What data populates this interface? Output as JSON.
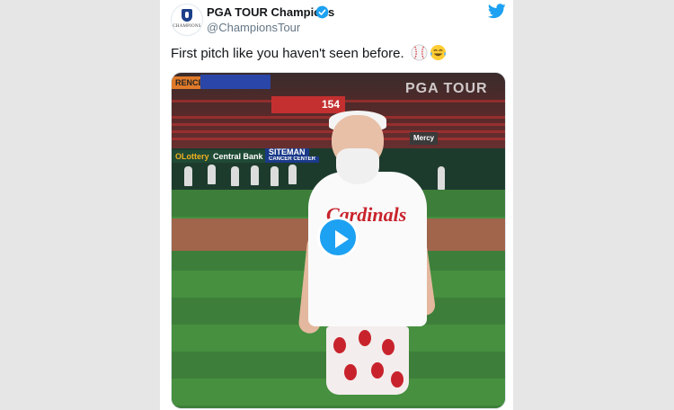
{
  "tweet": {
    "author_name": "PGA TOUR Champions",
    "author_handle": "@ChampionsTour",
    "avatar_text": "CHAMPIONS",
    "text": "First pitch like you haven't seen before.",
    "emojis": [
      "baseball-emoji",
      "tears-of-joy-emoji"
    ]
  },
  "media": {
    "signs": {
      "left_edge": "RENCE",
      "lottery": "OLottery",
      "central_bank": "Central Bank",
      "siteman": "SITEMAN",
      "siteman_sub": "CANCER CENTER",
      "scoreboard": "154",
      "watermark": "PGA TOUR",
      "mercy": "Mercy"
    },
    "jersey_wordmark": "Cardinals"
  },
  "colors": {
    "twitter_blue": "#1da1f2",
    "page_bg": "#e6e6e6",
    "cardinals_red": "#c8232c"
  }
}
